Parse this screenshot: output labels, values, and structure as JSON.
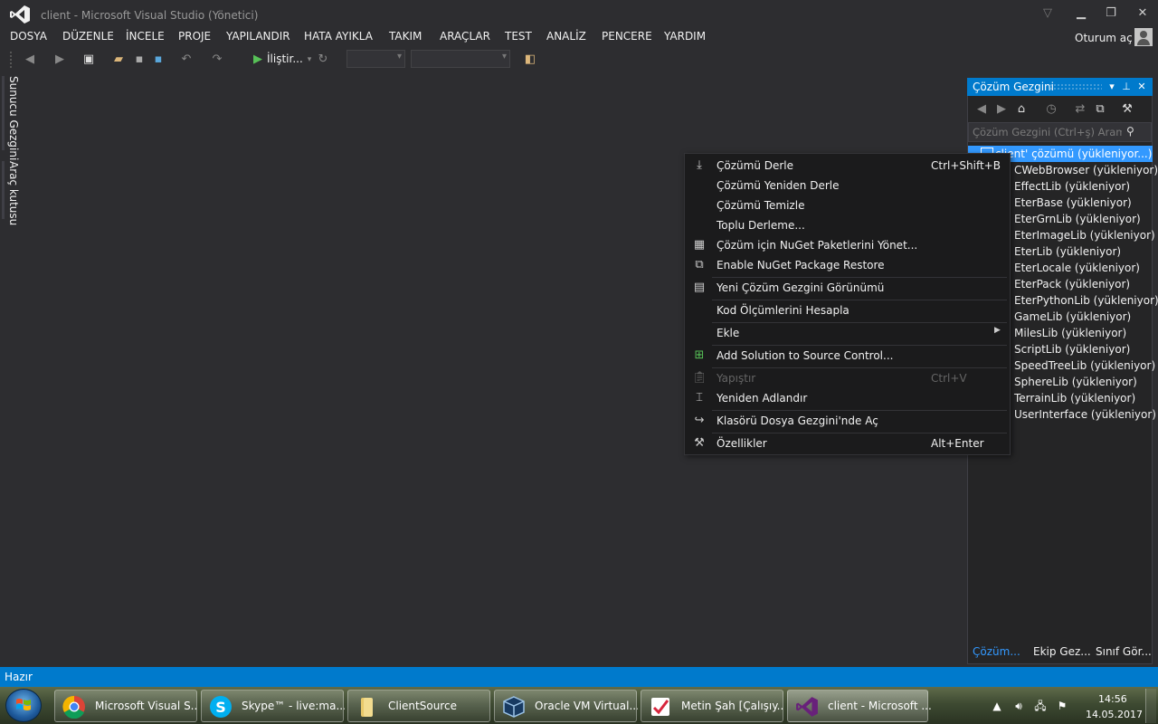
{
  "window": {
    "title": "client - Microsoft Visual Studio (Yönetici)"
  },
  "menu": [
    "DOSYA",
    "DÜZENLE",
    "İNCELE",
    "PROJE",
    "YAPILANDIR",
    "HATA AYIKLA",
    "TAKIM",
    "ARAÇLAR",
    "TEST",
    "ANALİZ",
    "PENCERE",
    "YARDIM"
  ],
  "account": {
    "signin_label": "Oturum aç"
  },
  "toolbar": {
    "run_label": "İliştir..."
  },
  "side_tabs": [
    "Sunucu Gezgini",
    "Araç kutusu"
  ],
  "solution_explorer": {
    "title": "Çözüm Gezgini",
    "search_placeholder": "Çözüm Gezgini (Ctrl+ş) Arama",
    "root": "Çözüm 'client' (yükleniyor...)",
    "root_visible": "client'  çözümü (yükleniyor...)",
    "projects": [
      "CWebBrowser (yükleniyor)",
      "EffectLib (yükleniyor)",
      "EterBase (yükleniyor)",
      "EterGrnLib (yükleniyor)",
      "EterImageLib (yükleniyor)",
      "EterLib (yükleniyor)",
      "EterLocale (yükleniyor)",
      "EterPack (yükleniyor)",
      "EterPythonLib (yükleniyor)",
      "GameLib (yükleniyor)",
      "MilesLib (yükleniyor)",
      "ScriptLib (yükleniyor)",
      "SpeedTreeLib (yükleniyor)",
      "SphereLib (yükleniyor)",
      "TerrainLib (yükleniyor)",
      "UserInterface (yükleniyor)"
    ],
    "bottom_tabs": [
      "Çözüm...",
      "Ekip Gez...",
      "Sınıf Gör..."
    ]
  },
  "context_menu": {
    "items": [
      {
        "label": "Çözümü Derle",
        "shortcut": "Ctrl+Shift+B",
        "icon": "build-icon"
      },
      {
        "label": "Çözümü Yeniden Derle",
        "shortcut": "",
        "icon": ""
      },
      {
        "label": "Çözümü Temizle",
        "shortcut": "",
        "icon": ""
      },
      {
        "label": "Toplu Derleme...",
        "shortcut": "",
        "icon": ""
      },
      {
        "label": "Çözüm için NuGet Paketlerini Yönet...",
        "shortcut": "",
        "icon": "nuget-icon"
      },
      {
        "label": "Enable NuGet Package Restore",
        "shortcut": "",
        "icon": "package-restore-icon"
      },
      {
        "label": "Yeni Çözüm Gezgini Görünümü",
        "shortcut": "",
        "icon": "new-view-icon"
      },
      {
        "label": "Kod Ölçümlerini Hesapla",
        "shortcut": "",
        "icon": ""
      },
      {
        "label": "Ekle",
        "shortcut": "",
        "icon": ""
      },
      {
        "label": "Add Solution to Source Control...",
        "shortcut": "",
        "icon": "source-control-icon"
      },
      {
        "label": "Yapıştır",
        "shortcut": "Ctrl+V",
        "icon": "paste-icon"
      },
      {
        "label": "Yeniden Adlandır",
        "shortcut": "",
        "icon": "rename-icon"
      },
      {
        "label": "Klasörü Dosya Gezgini'nde Aç",
        "shortcut": "",
        "icon": "open-folder-icon"
      },
      {
        "label": "Özellikler",
        "shortcut": "Alt+Enter",
        "icon": "wrench-icon"
      }
    ]
  },
  "status": {
    "text": "Hazır",
    "accent": "#007acc"
  },
  "taskbar": {
    "buttons": [
      "Microsoft Visual S...",
      "Skype™ - live:ma...",
      "ClientSource",
      "Oracle VM Virtual...",
      "Metin Şah [Çalışıy...",
      "client - Microsoft ..."
    ],
    "time": "14:56",
    "date": "14.05.2017"
  }
}
